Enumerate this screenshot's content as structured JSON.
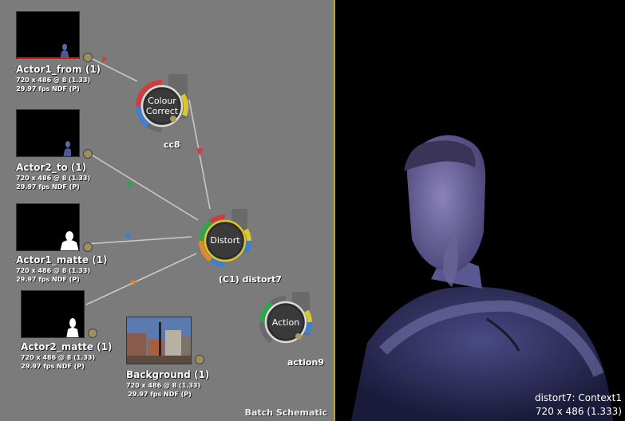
{
  "schematic": {
    "label": "Batch Schematic",
    "clips": [
      {
        "name": "Actor1_from (1)",
        "res": "720 x 486 @ 8 (1.33)",
        "rate": "29.97 fps NDF (P)"
      },
      {
        "name": "Actor2_to (1)",
        "res": "720 x 486 @ 8 (1.33)",
        "rate": "29.97 fps NDF (P)"
      },
      {
        "name": "Actor1_matte (1)",
        "res": "720 x 486 @ 8 (1.33)",
        "rate": "29.97 fps NDF (P)"
      },
      {
        "name": "Actor2_matte (1)",
        "res": "720 x 486 @ 8 (1.33)",
        "rate": "29.97 fps NDF (P)"
      },
      {
        "name": "Background (1)",
        "res": "720 x 486 @ 8 (1.33)",
        "rate": "29.97 fps NDF (P)"
      }
    ],
    "nodes": {
      "colour_correct": {
        "label_line1": "Colour",
        "label_line2": "Correct",
        "name": "cc8"
      },
      "distort": {
        "label": "Distort",
        "name": "(C1)  distort7"
      },
      "action": {
        "label": "Action",
        "name": "action9"
      }
    },
    "colors": {
      "red": "#d23c3c",
      "green": "#2fa44a",
      "blue": "#3d7fd0",
      "orange": "#e0892a",
      "yellow": "#d8c82a",
      "grey": "#6a6a6a"
    }
  },
  "viewer": {
    "context_line": "distort7: Context1",
    "res_line": "720 x 486 (1.333)"
  }
}
